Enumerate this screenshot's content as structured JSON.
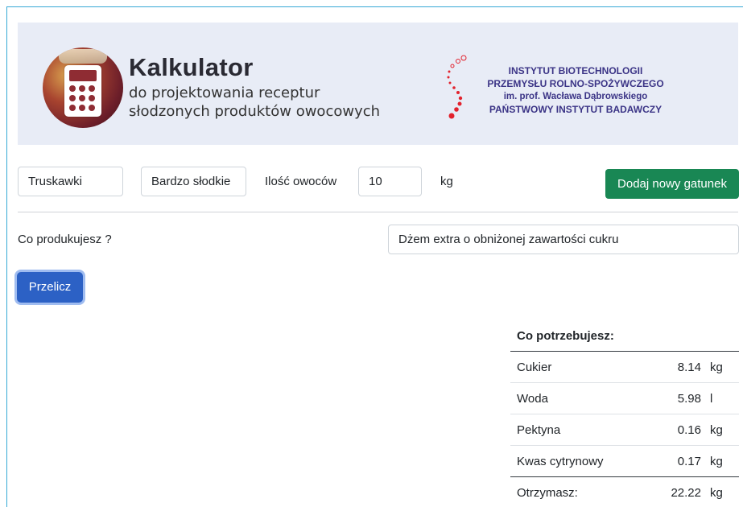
{
  "header": {
    "title": "Kalkulator",
    "subtitle_line1": "do projektowania receptur",
    "subtitle_line2": "słodzonych produktów owocowych",
    "logo_icon": "calculator-icon",
    "institute": {
      "line1": "INSTYTUT BIOTECHNOLOGII",
      "line2": "PRZEMYSŁU ROLNO-SPOŻYWCZEGO",
      "line3": "im. prof. Wacława Dąbrowskiego",
      "line4": "PAŃSTWOWY INSTYTUT BADAWCZY"
    }
  },
  "fruit_row": {
    "fruit": "Truskawki",
    "sweetness": "Bardzo słodkie",
    "quantity_label": "Ilość owoców",
    "quantity_value": "10",
    "unit": "kg",
    "add_button": "Dodaj nowy gatunek"
  },
  "product": {
    "label": "Co produkujesz ?",
    "value": "Dżem extra o obniżonej zawartości cukru"
  },
  "calculate_button": "Przelicz",
  "results": {
    "heading": "Co potrzebujesz:",
    "rows": [
      {
        "name": "Cukier",
        "value": "8.14",
        "unit": "kg"
      },
      {
        "name": "Woda",
        "value": "5.98",
        "unit": "l"
      },
      {
        "name": "Pektyna",
        "value": "0.16",
        "unit": "kg"
      },
      {
        "name": "Kwas cytrynowy",
        "value": "0.17",
        "unit": "kg"
      }
    ],
    "total": {
      "name": "Otrzymasz:",
      "value": "22.22",
      "unit": "kg"
    }
  },
  "colors": {
    "accent_green": "#198754",
    "accent_blue": "#2c61c5",
    "institute_text": "#3b3486",
    "institute_dots": "#e2222d"
  }
}
